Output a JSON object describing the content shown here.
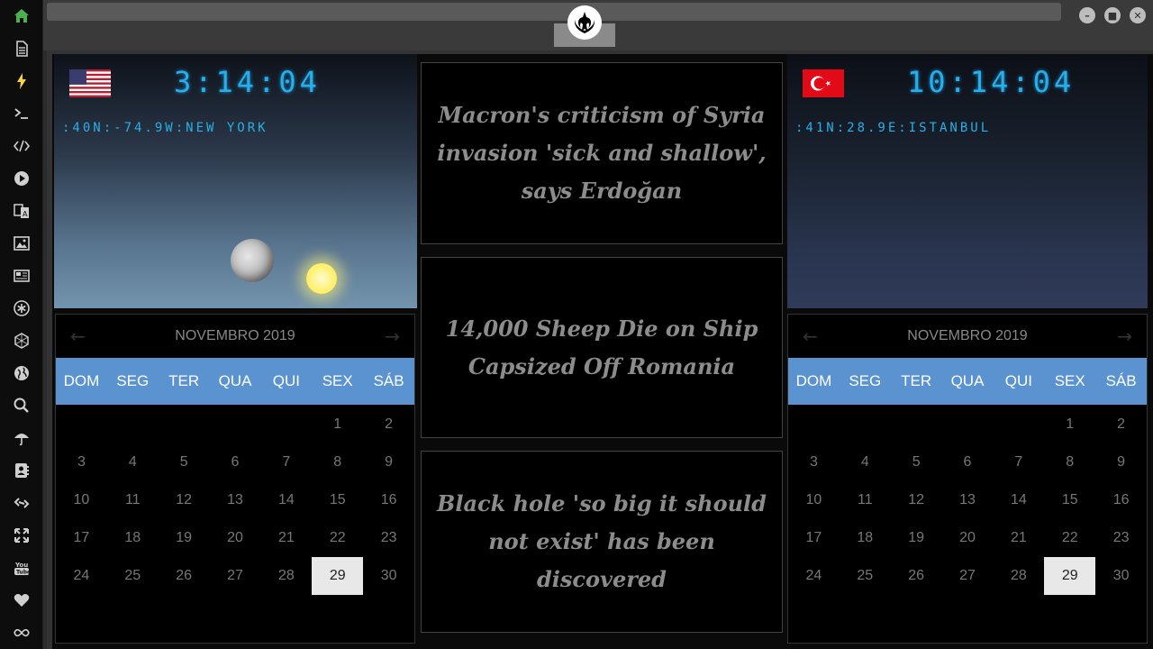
{
  "sidebar": {
    "items": [
      {
        "icon": "home-icon"
      },
      {
        "icon": "document-icon"
      },
      {
        "icon": "lightning-icon"
      },
      {
        "icon": "terminal-icon"
      },
      {
        "icon": "code-icon"
      },
      {
        "icon": "play-icon"
      },
      {
        "icon": "translate-icon"
      },
      {
        "icon": "image-icon"
      },
      {
        "icon": "newspaper-icon"
      },
      {
        "icon": "asterisk-icon"
      },
      {
        "icon": "hexagon-icon"
      },
      {
        "icon": "globe-icon"
      },
      {
        "icon": "search-icon"
      },
      {
        "icon": "umbrella-icon"
      },
      {
        "icon": "contacts-icon"
      },
      {
        "icon": "link-icon"
      },
      {
        "icon": "expand-icon"
      },
      {
        "icon": "youtube-icon"
      },
      {
        "icon": "heart-icon"
      },
      {
        "icon": "infinity-icon"
      }
    ]
  },
  "colors": {
    "accent": "#2aaee8",
    "weekday_bar": "#5b93d0",
    "home_icon": "#4caf50",
    "lightning_icon": "#f5d442"
  },
  "left_city": {
    "clock": "3:14:04",
    "coords": ":40N:-74.9W:NEW YORK"
  },
  "right_city": {
    "clock": "10:14:04",
    "coords": ":41N:28.9E:ISTANBUL"
  },
  "calendar": {
    "month_label": "NOVEMBRO 2019",
    "prev": "←",
    "next": "→",
    "weekdays": [
      "DOM",
      "SEG",
      "TER",
      "QUA",
      "QUI",
      "SEX",
      "SÁB"
    ],
    "weeks": [
      [
        "",
        "",
        "",
        "",
        "",
        "1",
        "2"
      ],
      [
        "3",
        "4",
        "5",
        "6",
        "7",
        "8",
        "9"
      ],
      [
        "10",
        "11",
        "12",
        "13",
        "14",
        "15",
        "16"
      ],
      [
        "17",
        "18",
        "19",
        "20",
        "21",
        "22",
        "23"
      ],
      [
        "24",
        "25",
        "26",
        "27",
        "28",
        "29",
        "30"
      ]
    ],
    "today": "29"
  },
  "news": [
    "Macron's criticism of Syria invasion 'sick and shallow', says Erdoğan",
    "14,000 Sheep Die on Ship Capsized Off Romania",
    "Black hole 'so big it should not exist' has been discovered"
  ]
}
